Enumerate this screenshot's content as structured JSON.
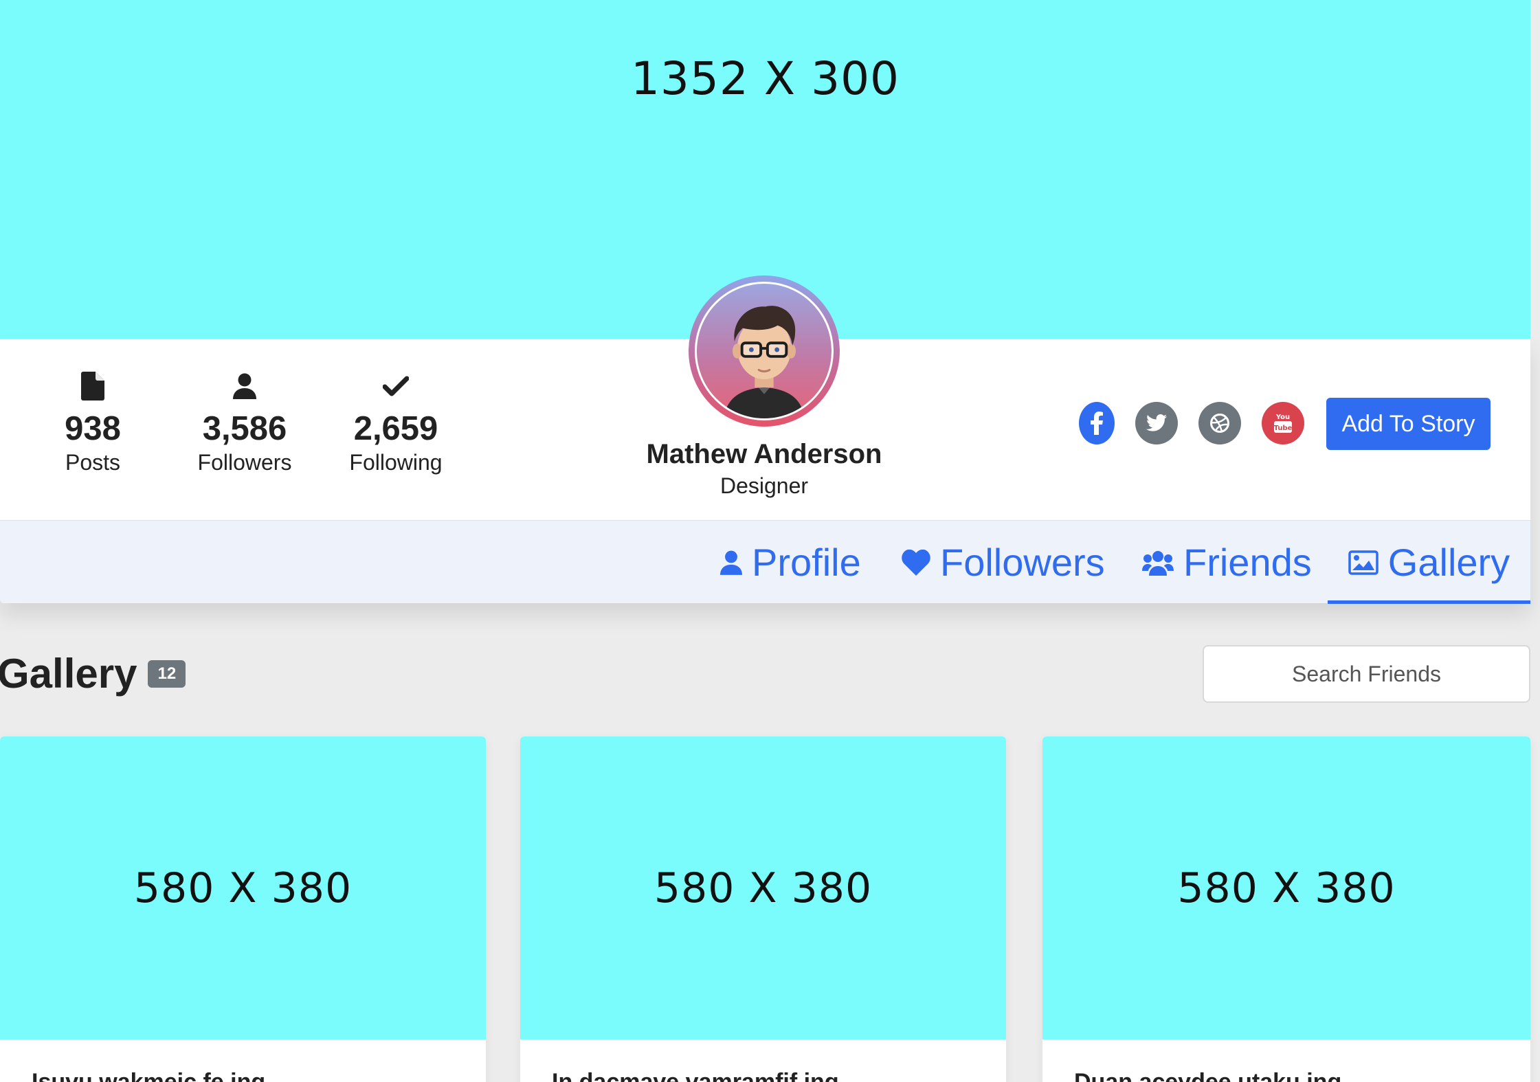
{
  "cover": {
    "placeholder": "1352 X 300"
  },
  "stats": [
    {
      "icon": "file-icon",
      "value": "938",
      "label": "Posts"
    },
    {
      "icon": "user-icon",
      "value": "3,586",
      "label": "Followers"
    },
    {
      "icon": "check-icon",
      "value": "2,659",
      "label": "Following"
    }
  ],
  "profile": {
    "name": "Mathew Anderson",
    "role": "Designer"
  },
  "social": [
    "facebook-icon",
    "twitter-icon",
    "dribbble-icon",
    "youtube-icon"
  ],
  "add_story_label": "Add To Story",
  "tabs": [
    {
      "label": "Profile",
      "icon": "user-icon",
      "active": false
    },
    {
      "label": "Followers",
      "icon": "heart-icon",
      "active": false
    },
    {
      "label": "Friends",
      "icon": "users-icon",
      "active": false
    },
    {
      "label": "Gallery",
      "icon": "image-icon",
      "active": true
    }
  ],
  "gallery": {
    "title": "Gallery",
    "count": "12",
    "search_placeholder": "Search Friends",
    "cards": [
      {
        "placeholder": "580 X 380",
        "caption": "Isuvu wakmeic fe ing"
      },
      {
        "placeholder": "580 X 380",
        "caption": "In dacmave vamramfif ing"
      },
      {
        "placeholder": "580 X 380",
        "caption": "Duan aceydee utaku ing"
      }
    ]
  },
  "colors": {
    "accent": "#2f6cf0",
    "placeholder_bg": "#7afcfd",
    "youtube": "#d9434e",
    "neutral": "#6d757d"
  }
}
